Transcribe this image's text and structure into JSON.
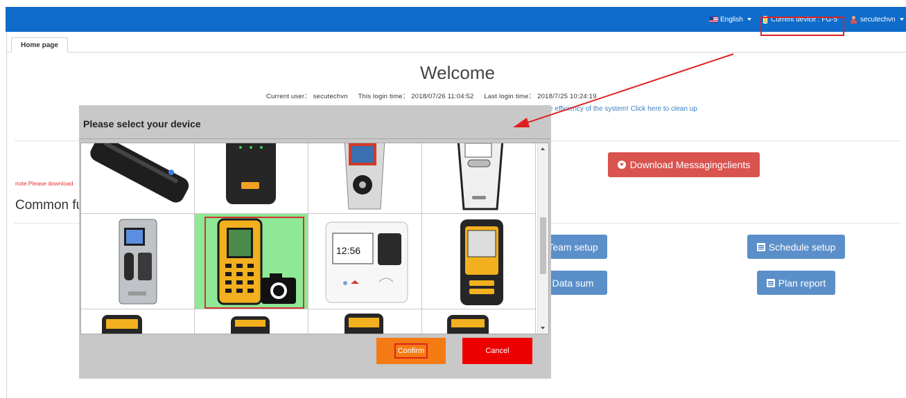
{
  "header": {
    "language": "English",
    "current_device": "Current device : FG-5",
    "user": "secutechvn"
  },
  "tabs": [
    {
      "label": "Home page"
    }
  ],
  "welcome": {
    "title": "Welcome",
    "current_user": "Current user： secutechvn",
    "login_time": "This login time： 2018/07/26 11:04:52",
    "last_login": "Last login time： 2018/7/25 10:24:19",
    "cleanup_text": "e efficiency of the system! Click here to clean up"
  },
  "note": "note:Please download",
  "common_heading": "Common fu",
  "buttons": {
    "download": "Download Messagingclients",
    "team_setup": "Team setup",
    "schedule_setup": "Schedule setup",
    "data_sum": "Data sum",
    "plan_report": "Plan report"
  },
  "dialog": {
    "title": "Please select your device",
    "confirm": "Confirm",
    "cancel": "Cancel",
    "selected_device_index": 5,
    "scroll_position": 0.45
  },
  "colors": {
    "topbar": "#0f6ccb",
    "download_button": "#d9534f",
    "action_button": "#5b8fc9",
    "confirm": "#f47b13",
    "cancel": "#ee0000",
    "selected_cell": "#8fe895",
    "highlight_border": "#e02020"
  }
}
